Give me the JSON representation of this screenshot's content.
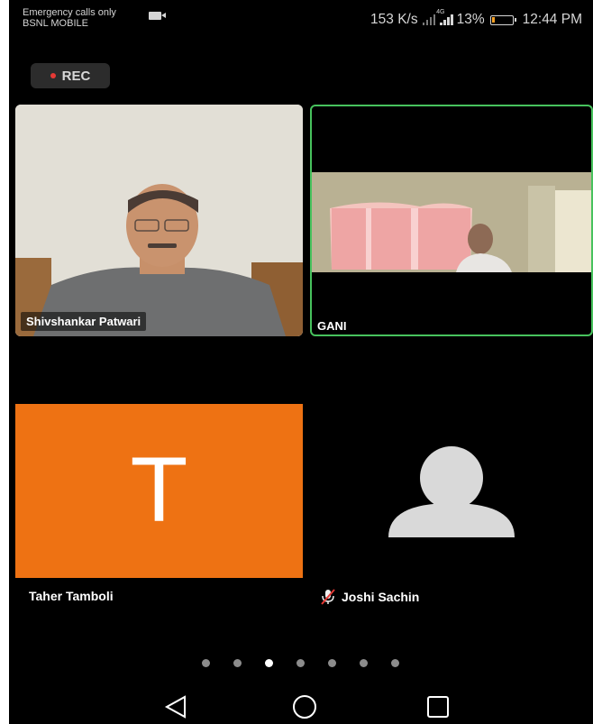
{
  "status_bar": {
    "carrier_line1": "Emergency calls only",
    "carrier_line2": "BSNL MOBILE",
    "net_speed": "153 K/s",
    "network_tag": "4G",
    "battery_percent": "13%",
    "battery_level": 0.13,
    "battery_color": "#f6a023",
    "time": "12:44 PM"
  },
  "recording": {
    "label": "REC",
    "dot_color": "#e53935"
  },
  "participants": [
    {
      "name": "Shivshankar Patwari",
      "video": true
    },
    {
      "name": "GANI",
      "video": true,
      "active_speaker": true,
      "highlight_color": "#47c25d"
    },
    {
      "name": "Taher Tamboli",
      "video": false,
      "avatar_letter": "T",
      "avatar_color": "#ee7213"
    },
    {
      "name": "Joshi Sachin",
      "video": false,
      "muted": true
    }
  ],
  "pagination": {
    "total": 7,
    "active_index": 2
  },
  "nav_bar": {
    "back_icon": "back-triangle-icon",
    "home_icon": "home-circle-icon",
    "recents_icon": "recents-square-icon"
  }
}
